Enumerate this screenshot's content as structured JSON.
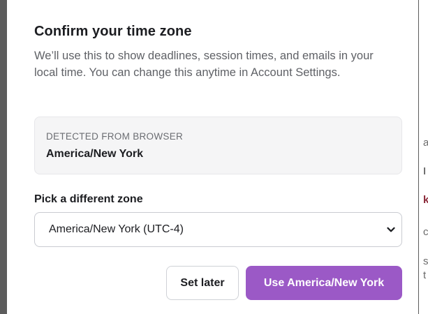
{
  "modal": {
    "title": "Confirm your time zone",
    "description": "We’ll use this to show deadlines, session times, and emails in your local time. You can change this anytime in Account Settings.",
    "detected": {
      "label": "DETECTED FROM BROWSER",
      "value": "America/New York"
    },
    "picker": {
      "label": "Pick a different zone",
      "selected": "America/New York (UTC-4)",
      "icon": "chevron-down-icon"
    },
    "buttons": {
      "secondary": "Set later",
      "primary": "Use America/New York"
    }
  },
  "background_fragments": [
    "a",
    "I",
    "k",
    "c",
    "s",
    "t"
  ],
  "colors": {
    "primary": "#9b59c6",
    "backdrop": "#5c5c5c",
    "panel": "#f5f5f6"
  }
}
